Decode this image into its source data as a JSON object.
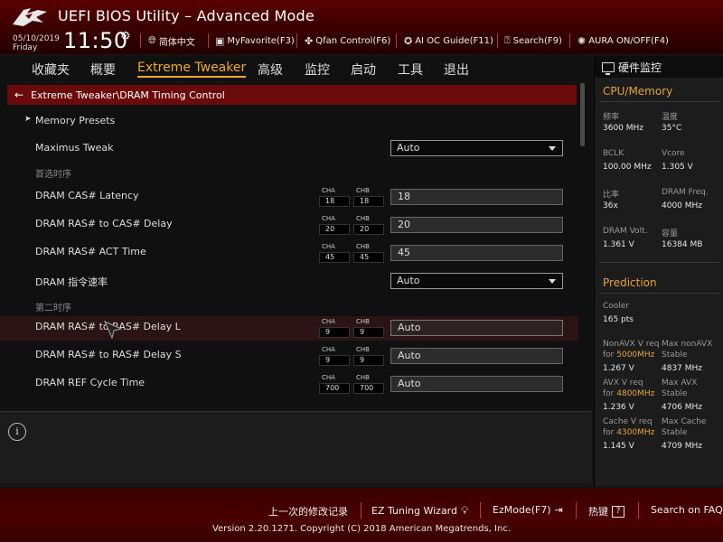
{
  "header": {
    "title": "UEFI BIOS Utility – Advanced Mode",
    "date": "05/10/2019",
    "day": "Friday",
    "time": "11:50",
    "toolbar": [
      {
        "icon": "globe-icon",
        "label": "简体中文"
      },
      {
        "icon": "favorite-icon",
        "label": "MyFavorite(F3)"
      },
      {
        "icon": "fan-icon",
        "label": "Qfan Control(F6)"
      },
      {
        "icon": "ai-oc-icon",
        "label": "AI OC Guide(F11)"
      },
      {
        "icon": "search-icon",
        "label": "Search(F9)"
      },
      {
        "icon": "aura-icon",
        "label": "AURA ON/OFF(F4)"
      }
    ]
  },
  "menu": [
    "收藏夹",
    "概要",
    "Extreme Tweaker",
    "高级",
    "监控",
    "启动",
    "工具",
    "退出"
  ],
  "active_menu": "Extreme Tweaker",
  "breadcrumb": "Extreme Tweaker\\DRAM Timing Control",
  "rows": {
    "memory_presets": "Memory Presets",
    "maximus_tweak": {
      "label": "Maximus Tweak",
      "value": "Auto"
    },
    "section1": "首选时序",
    "cas": {
      "label": "DRAM CAS# Latency",
      "cha": "18",
      "chb": "18",
      "value": "18"
    },
    "ras_cas": {
      "label": "DRAM RAS# to CAS# Delay",
      "cha": "20",
      "chb": "20",
      "value": "20"
    },
    "ras_act": {
      "label": "DRAM RAS# ACT Time",
      "cha": "45",
      "chb": "45",
      "value": "45"
    },
    "cmd_rate": {
      "label": "DRAM 指令速率",
      "value": "Auto"
    },
    "section2": "第二时序",
    "ras_ras_l": {
      "label": "DRAM RAS# to RAS# Delay L",
      "cha": "9",
      "chb": "9",
      "value": "Auto"
    },
    "ras_ras_s": {
      "label": "DRAM RAS# to RAS# Delay S",
      "cha": "9",
      "chb": "9",
      "value": "Auto"
    },
    "ref_cycle": {
      "label": "DRAM REF Cycle Time",
      "cha": "700",
      "chb": "700",
      "value": "Auto"
    }
  },
  "ch_labels": {
    "a": "CHA",
    "b": "CHB"
  },
  "hw_monitor": {
    "title": "硬件监控",
    "cpu_mem_title": "CPU/Memory",
    "freq_label": "频率",
    "freq": "3600 MHz",
    "temp_label": "温度",
    "temp": "35°C",
    "bclk_label": "BCLK",
    "bclk": "100.00 MHz",
    "vcore_label": "Vcore",
    "vcore": "1.305 V",
    "ratio_label": "比率",
    "ratio": "36x",
    "dram_freq_label": "DRAM Freq.",
    "dram_freq": "4000 MHz",
    "dram_volt_label": "DRAM Volt.",
    "dram_volt": "1.361 V",
    "capacity_label": "容量",
    "capacity": "16384 MB",
    "prediction_title": "Prediction",
    "cooler_label": "Cooler",
    "cooler": "165 pts",
    "nonavx_label": "NonAVX V req",
    "nonavx_for": "for",
    "nonavx_freq": "5000MHz",
    "nonavx_v": "1.267 V",
    "max_nonavx_label": "Max nonAVX",
    "max_nonavx_stable": "Stable",
    "max_nonavx": "4837 MHz",
    "avx_label": "AVX V req",
    "avx_for": "for",
    "avx_freq": "4800MHz",
    "avx_v": "1.236 V",
    "max_avx_label": "Max AVX",
    "max_avx_stable": "Stable",
    "max_avx": "4706 MHz",
    "cache_label": "Cache V req",
    "cache_for": "for",
    "cache_freq": "4300MHz",
    "cache_v": "1.145 V",
    "max_cache_label": "Max Cache",
    "max_cache_stable": "Stable",
    "max_cache": "4709 MHz"
  },
  "footer": {
    "last_modified": "上一次的修改记录",
    "ez_tuning": "EZ Tuning Wizard",
    "ezmode": "EzMode(F7)",
    "hotkeys": "热键",
    "hotkeys_key": "?",
    "search_faq": "Search on FAQ",
    "version": "Version 2.20.1271. Copyright (C) 2018 American Megatrends, Inc."
  },
  "colors": {
    "accent": "#f0a92a",
    "header_red": "#5a0000",
    "breadcrumb_red": "#6a0a0a"
  }
}
